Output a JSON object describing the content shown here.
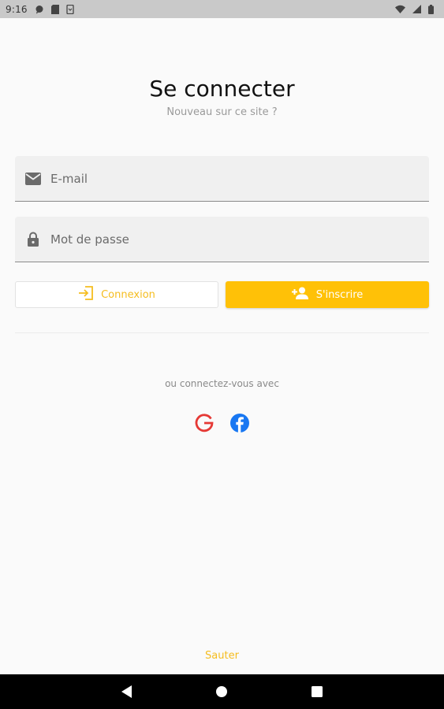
{
  "status_bar": {
    "time": "9:16",
    "icons_left": [
      "message-icon",
      "sd-card-icon",
      "download-icon"
    ],
    "icons_right": [
      "wifi-icon",
      "signal-icon",
      "battery-icon"
    ]
  },
  "header": {
    "title": "Se connecter",
    "subtitle": "Nouveau sur ce site ?"
  },
  "form": {
    "email_placeholder": "E-mail",
    "email_value": "",
    "password_placeholder": "Mot de passe",
    "password_value": ""
  },
  "actions": {
    "login_label": "Connexion",
    "signup_label": "S'inscrire"
  },
  "social": {
    "label": "ou connectez-vous avec",
    "providers": [
      "Google",
      "Facebook"
    ]
  },
  "footer": {
    "skip_label": "Sauter"
  },
  "colors": {
    "accent": "#ffc107",
    "accent_text": "#f5bd1f",
    "google": "#e53935",
    "facebook": "#1877f2",
    "background": "#fafafa"
  }
}
